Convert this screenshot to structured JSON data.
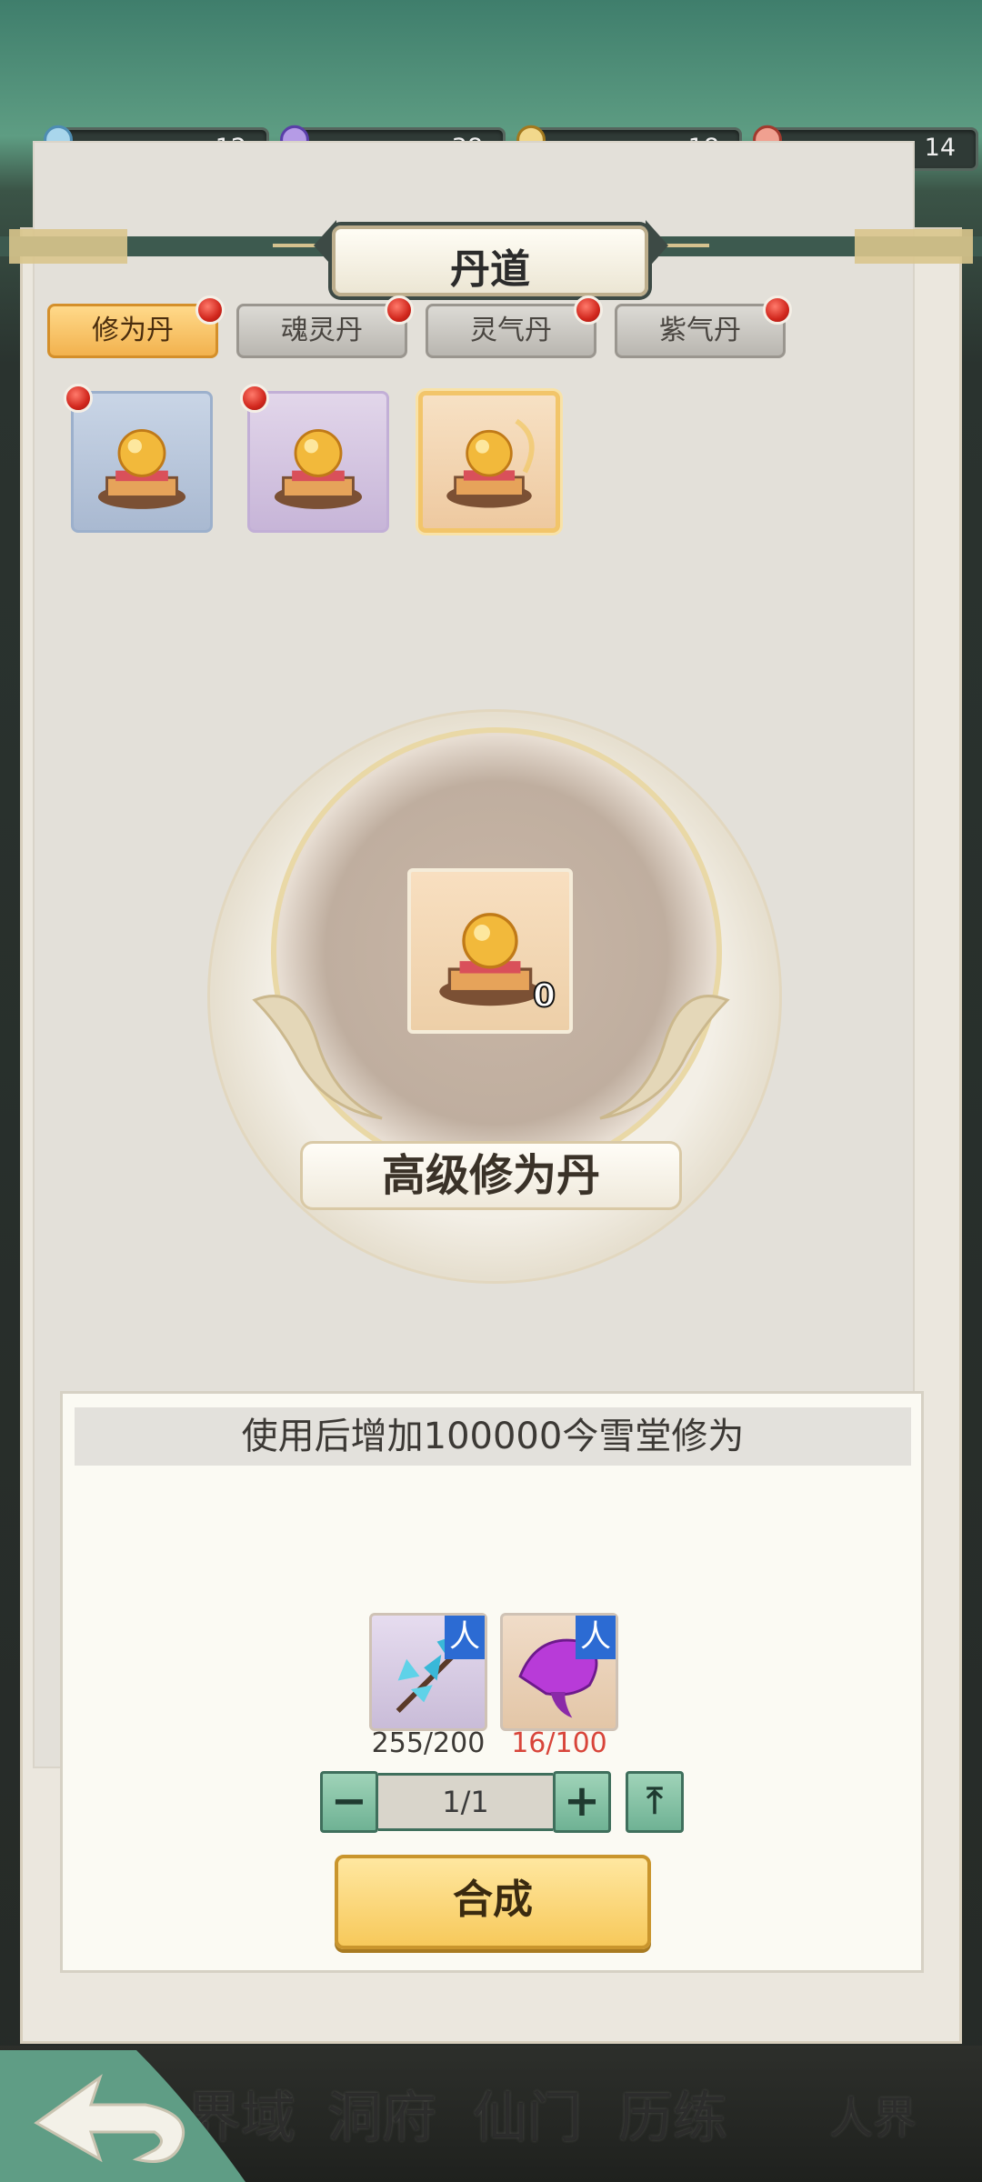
{
  "resources": [
    {
      "icon": "blue-spirit-icon",
      "value": "12",
      "color": "#7fb8d8"
    },
    {
      "icon": "purple-spirit-icon",
      "value": "38",
      "color": "#8a6fd0"
    },
    {
      "icon": "gold-spirit-icon",
      "value": "18",
      "color": "#e0b85a"
    },
    {
      "icon": "red-spirit-icon",
      "value": "14",
      "color": "#d8685a"
    }
  ],
  "panel": {
    "title": "丹道",
    "tabs": [
      "修为丹",
      "魂灵丹",
      "灵气丹",
      "紫气丹"
    ],
    "active_tab": 0
  },
  "items": [
    {
      "bg": "#b8c6da",
      "has_dot": true,
      "selected": false
    },
    {
      "bg": "#d6c6df",
      "has_dot": true,
      "selected": false
    },
    {
      "bg": "#f3d5b2",
      "has_dot": false,
      "selected": true
    }
  ],
  "selected_item": {
    "count": "0",
    "name": "高级修为丹",
    "description": "使用后增加100000今雪堂修为"
  },
  "materials": [
    {
      "icon": "blue-flower-icon",
      "badge": "人",
      "count": "255/200",
      "count_color": "#3c3935"
    },
    {
      "icon": "purple-mushroom-icon",
      "badge": "人",
      "count": "16/100",
      "count_color": "#d8453a"
    }
  ],
  "quantity": {
    "minus": "−",
    "value": "1/1",
    "plus": "+",
    "max": "⤒"
  },
  "synth_button": "合成",
  "bottom_nav": [
    "界域",
    "洞府",
    "仙门",
    "历练",
    "人界"
  ]
}
